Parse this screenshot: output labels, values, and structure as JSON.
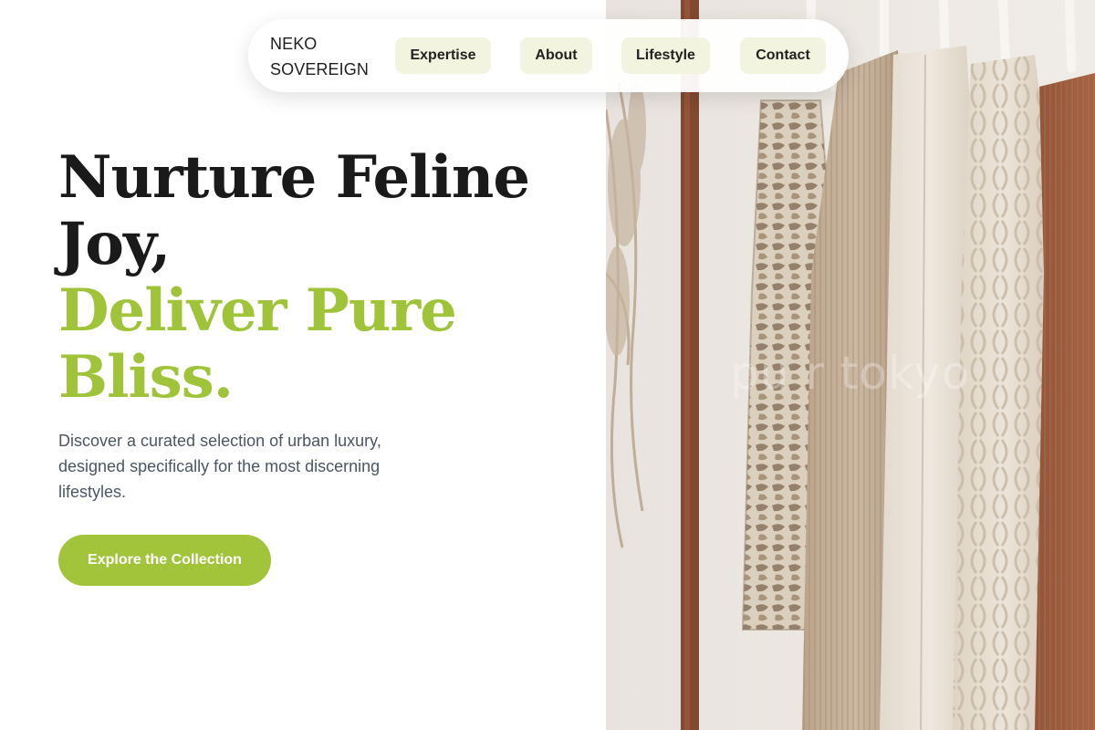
{
  "brand": {
    "line1": "NEKO",
    "line2": "SOVEREIGN"
  },
  "nav": {
    "links": [
      {
        "label": "Expertise"
      },
      {
        "label": "About"
      },
      {
        "label": "Lifestyle"
      },
      {
        "label": "Contact"
      }
    ]
  },
  "hero": {
    "headline_dark_1": "Nurture Feline",
    "headline_dark_2": "Joy,",
    "headline_accent_1": "Deliver Pure",
    "headline_accent_2": "Bliss.",
    "subtitle": "Discover a curated selection of urban luxury, designed specifically for the most discerning lifestyles.",
    "cta_label": "Explore the Collection",
    "image_watermark": "pu r tokyo"
  },
  "colors": {
    "accent": "#9fc439",
    "button": "#a1c43b",
    "nav_link_bg": "#f3f4df",
    "text_dark": "#1a1a1a",
    "text_muted": "#4b5563"
  }
}
